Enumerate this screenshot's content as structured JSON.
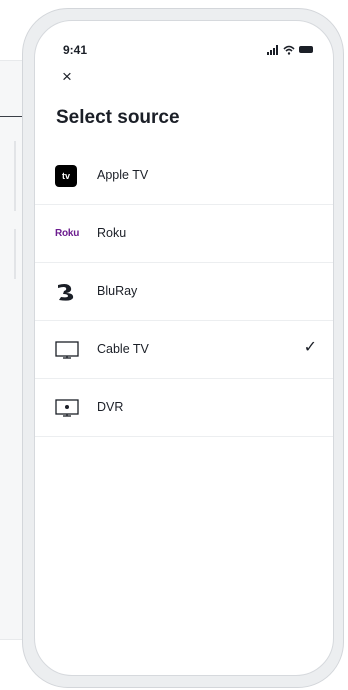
{
  "status_bar": {
    "time": "9:41"
  },
  "header": {
    "close_glyph": "×",
    "title": "Select source"
  },
  "sources": [
    {
      "label": "Apple TV",
      "icon": "apple-tv-icon",
      "icon_text": "tv",
      "selected": false
    },
    {
      "label": "Roku",
      "icon": "roku-logo-icon",
      "icon_text": "Roku",
      "selected": false
    },
    {
      "label": "BluRay",
      "icon": "bluray-logo-icon",
      "selected": false
    },
    {
      "label": "Cable TV",
      "icon": "tv-monitor-icon",
      "selected": true
    },
    {
      "label": "DVR",
      "icon": "dvr-icon",
      "selected": false
    }
  ],
  "check_glyph": "✓",
  "colors": {
    "text": "#1b1f27",
    "roku_brand": "#6c1d8f",
    "divider": "#eceef0"
  }
}
